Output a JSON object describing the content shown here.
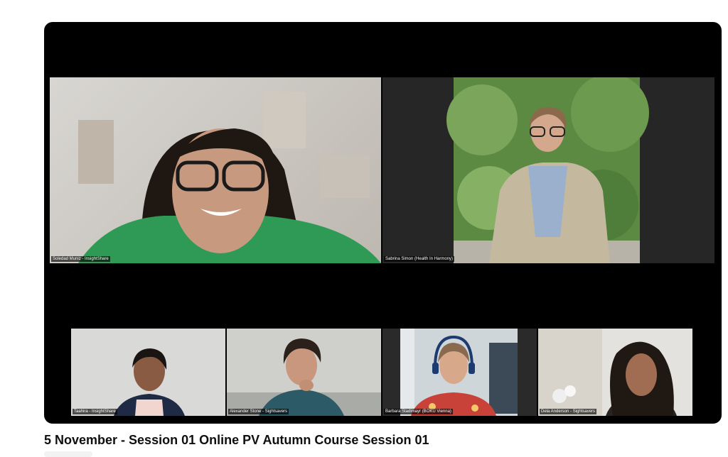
{
  "video": {
    "title": "5 November - Session 01 Online PV Autumn Course Session 01"
  },
  "participants": [
    {
      "name": "Soledad Muniz - InsightShare"
    },
    {
      "name": "Sabrina Simon (Health In Harmony)"
    },
    {
      "name": "Taahira - InsightShare"
    },
    {
      "name": "Alexander Stone - Sightsavers"
    },
    {
      "name": "Barbara Stadlmayr (BOKU Vienna)"
    },
    {
      "name": "Dela Anderson - Sightsavers"
    }
  ],
  "icons": [
    "person-video-feed"
  ]
}
